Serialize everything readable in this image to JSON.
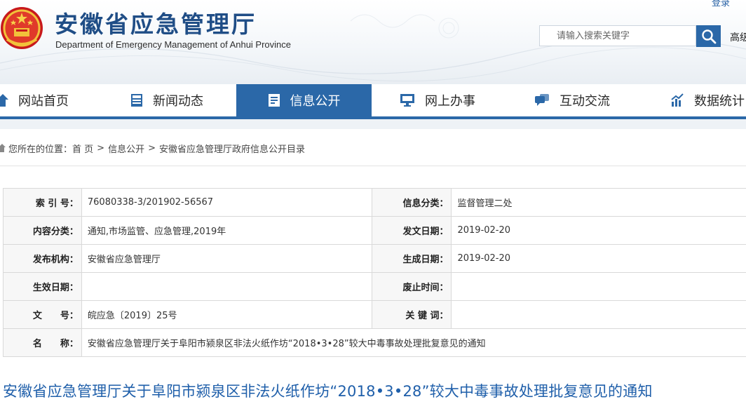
{
  "header": {
    "title": "安徽省应急管理厅",
    "subtitle": "Department of Emergency Management of Anhui Province",
    "top_link": "登录",
    "search": {
      "placeholder": "请输入搜索关键字"
    },
    "advanced_search": "高级",
    "brand_color": "#2b68a8",
    "title_color": "#1f4d86"
  },
  "nav": {
    "items": [
      {
        "label": "网站首页",
        "icon": "home-icon"
      },
      {
        "label": "新闻动态",
        "icon": "news-icon"
      },
      {
        "label": "信息公开",
        "icon": "document-icon",
        "active": true
      },
      {
        "label": "网上办事",
        "icon": "monitor-icon"
      },
      {
        "label": "互动交流",
        "icon": "chat-icon"
      },
      {
        "label": "数据统计",
        "icon": "chart-icon"
      }
    ]
  },
  "breadcrumb": {
    "prefix": "您所在的位置：",
    "items": [
      "首 页",
      "信息公开",
      "安徽省应急管理厅政府信息公开目录"
    ],
    "separator": ">"
  },
  "meta": {
    "rows": [
      {
        "l1": "索 引 号：",
        "v1": "76080338-3/201902-56567",
        "l2": "信息分类：",
        "v2": "监督管理二处"
      },
      {
        "l1": "内容分类：",
        "v1": "通知,市场监管、应急管理,2019年",
        "l2": "发文日期：",
        "v2": "2019-02-20"
      },
      {
        "l1": "发布机构：",
        "v1": "安徽省应急管理厅",
        "l2": "生成日期：",
        "v2": "2019-02-20"
      },
      {
        "l1": "生效日期：",
        "v1": "",
        "l2": "废止时间：",
        "v2": ""
      },
      {
        "l1": "文　　号：",
        "v1": "皖应急〔2019〕25号",
        "l2": "关 键 词：",
        "v2": ""
      }
    ],
    "name_label": "名　　称：",
    "name_value": "安徽省应急管理厅关于阜阳市颍泉区非法火纸作坊“2018•3•28”较大中毒事故处理批复意见的通知"
  },
  "article": {
    "title": "安徽省应急管理厅关于阜阳市颍泉区非法火纸作坊“2018•3•28”较大中毒事故处理批复意见的通知",
    "title_color": "#1f5faa"
  }
}
